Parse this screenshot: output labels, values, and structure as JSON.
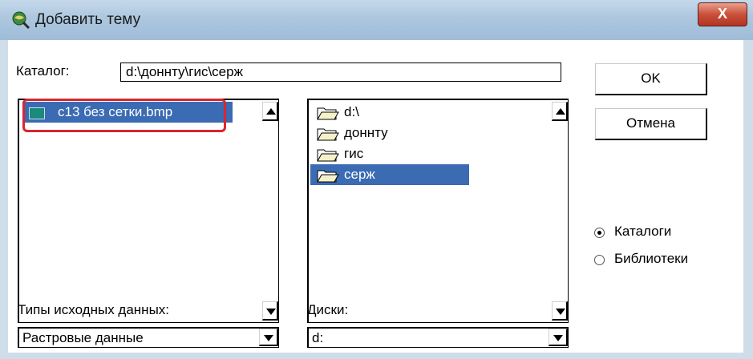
{
  "window": {
    "title": "Добавить тему",
    "close_label": "X"
  },
  "catalog": {
    "label": "Каталог:",
    "path": "d:\\доннту\\гис\\серж"
  },
  "buttons": {
    "ok": "OK",
    "cancel": "Отмена"
  },
  "files": [
    {
      "name": "c13 без сетки.bmp",
      "selected": true
    }
  ],
  "directories": [
    {
      "name": "d:\\",
      "selected": false
    },
    {
      "name": "доннту",
      "selected": false
    },
    {
      "name": "гис",
      "selected": false
    },
    {
      "name": "серж",
      "selected": true
    }
  ],
  "mode": {
    "options": [
      {
        "label": "Каталоги",
        "checked": true
      },
      {
        "label": "Библиотеки",
        "checked": false
      }
    ]
  },
  "source_types": {
    "label": "Типы исходных данных:",
    "value": "Растровые данные"
  },
  "drives": {
    "label": "Диски:",
    "value": "d:"
  },
  "colors": {
    "selection": "#3a6bb3",
    "highlight": "#d8262f"
  }
}
